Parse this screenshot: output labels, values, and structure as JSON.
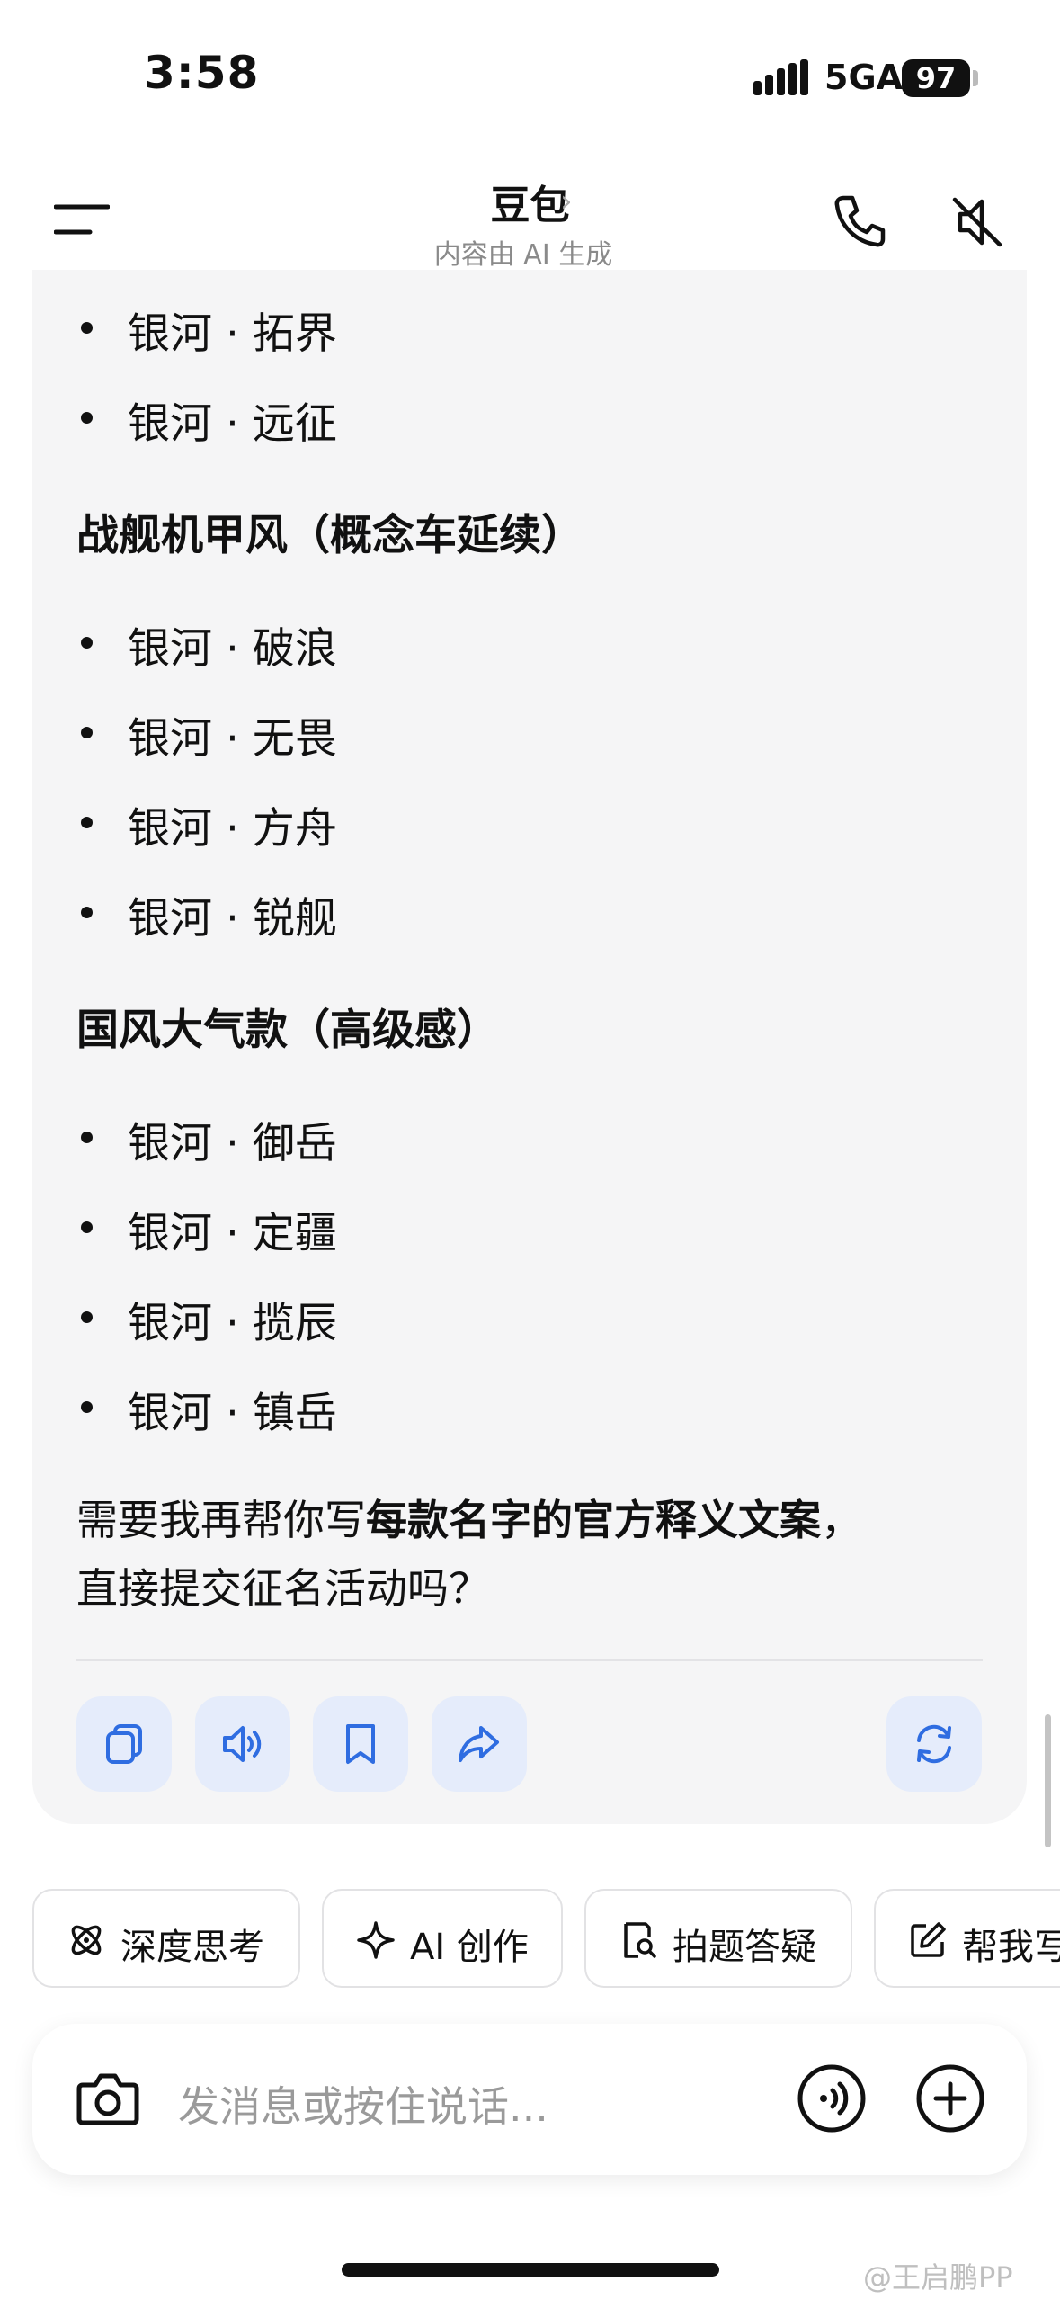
{
  "status": {
    "time": "3:58",
    "network": "5GA",
    "battery": "97"
  },
  "header": {
    "title": "豆包",
    "title_chevron": "›",
    "subtitle": "内容由 AI 生成"
  },
  "chat": {
    "group1": [
      "银河 · 拓界",
      "银河 · 远征"
    ],
    "section2": "战舰机甲风（概念车延续）",
    "group2": [
      "银河 · 破浪",
      "银河 · 无畏",
      "银河 · 方舟",
      "银河 · 锐舰"
    ],
    "section3": "国风大气款（高级感）",
    "group3": [
      "银河 · 御岳",
      "银河 · 定疆",
      "银河 · 揽辰",
      "银河 · 镇岳"
    ],
    "closing": {
      "pre": "需要我再帮你写",
      "bold": "每款名字的官方释义文案",
      "post": "，",
      "line2": "直接提交征名活动吗？"
    }
  },
  "actions": [
    "copy-icon",
    "speaker-icon",
    "bookmark-icon",
    "share-icon",
    "regenerate-icon"
  ],
  "chips": [
    "深度思考",
    "AI 创作",
    "拍题答疑",
    "帮我写"
  ],
  "input": {
    "placeholder": "发消息或按住说话..."
  },
  "watermark": "@王启鹏PP",
  "colors": {
    "accent": "#2f6de1",
    "action_bg": "#e5ecfb",
    "card_bg": "#f5f5f6"
  }
}
